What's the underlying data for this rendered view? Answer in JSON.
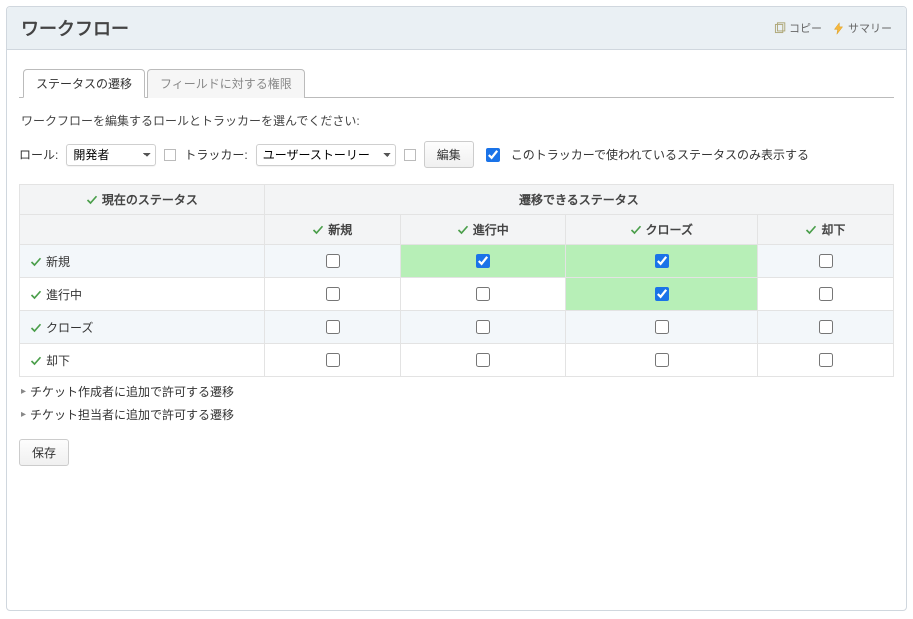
{
  "header": {
    "title": "ワークフロー",
    "links": {
      "copy": "コピー",
      "summary": "サマリー"
    }
  },
  "tabs": {
    "transitions": "ステータスの遷移",
    "field_perms": "フィールドに対する権限"
  },
  "instruction": "ワークフローを編集するロールとトラッカーを選んでください:",
  "filters": {
    "role_label": "ロール:",
    "role_value": "開発者",
    "tracker_label": "トラッカー:",
    "tracker_value": "ユーザーストーリー",
    "edit_button": "編集",
    "only_used_label": "このトラッカーで使われているステータスのみ表示する",
    "only_used_checked": true
  },
  "grid": {
    "current_status_header": "現在のステータス",
    "allowed_status_header": "遷移できるステータス",
    "columns": [
      "新規",
      "進行中",
      "クローズ",
      "却下"
    ],
    "rows": [
      {
        "label": "新規",
        "cells": [
          {
            "checked": false,
            "hl": false
          },
          {
            "checked": true,
            "hl": true
          },
          {
            "checked": true,
            "hl": true
          },
          {
            "checked": false,
            "hl": false
          }
        ]
      },
      {
        "label": "進行中",
        "cells": [
          {
            "checked": false,
            "hl": false
          },
          {
            "checked": false,
            "hl": false
          },
          {
            "checked": true,
            "hl": true
          },
          {
            "checked": false,
            "hl": false
          }
        ]
      },
      {
        "label": "クローズ",
        "cells": [
          {
            "checked": false,
            "hl": false
          },
          {
            "checked": false,
            "hl": false
          },
          {
            "checked": false,
            "hl": false
          },
          {
            "checked": false,
            "hl": false
          }
        ]
      },
      {
        "label": "却下",
        "cells": [
          {
            "checked": false,
            "hl": false
          },
          {
            "checked": false,
            "hl": false
          },
          {
            "checked": false,
            "hl": false
          },
          {
            "checked": false,
            "hl": false
          }
        ]
      }
    ]
  },
  "collapsibles": {
    "author": "チケット作成者に追加で許可する遷移",
    "assignee": "チケット担当者に追加で許可する遷移"
  },
  "save_button": "保存"
}
